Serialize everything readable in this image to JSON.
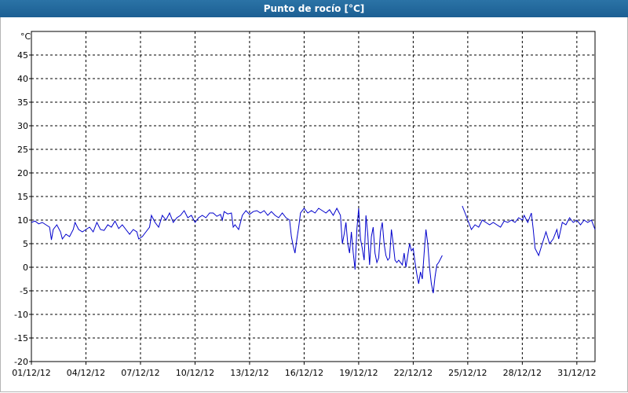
{
  "window": {
    "title": "Punto de rocío [°C]"
  },
  "chart_data": {
    "type": "line",
    "title": "Punto de rocío [°C]",
    "ylabel": "°C",
    "xlabel": "",
    "ylim": [
      -20,
      50
    ],
    "xlim": [
      0,
      31
    ],
    "y_ticks": [
      50,
      45,
      40,
      35,
      30,
      25,
      20,
      15,
      10,
      5,
      0,
      -5,
      -10,
      -15,
      -20
    ],
    "y_tick_labels": [
      "45",
      "40",
      "35",
      "30",
      "25",
      "20",
      "15",
      "10",
      "5",
      "0",
      "-5",
      "-10",
      "-15",
      "-20"
    ],
    "x_tick_labels": [
      "01/12/12",
      "04/12/12",
      "07/12/12",
      "10/12/12",
      "13/12/12",
      "16/12/12",
      "19/12/12",
      "22/12/12",
      "25/12/12",
      "28/12/12",
      "31/12/12"
    ],
    "x_tick_days": [
      0,
      3,
      6,
      9,
      12,
      15,
      18,
      21,
      24,
      27,
      30
    ],
    "grid": true,
    "line_color": "#0000cc",
    "series": [
      {
        "name": "",
        "segments": [
          [
            [
              0.0,
              9.5
            ],
            [
              0.2,
              9.8
            ],
            [
              0.4,
              9.2
            ],
            [
              0.6,
              9.5
            ],
            [
              0.8,
              9.0
            ],
            [
              1.0,
              8.5
            ],
            [
              1.1,
              5.8
            ],
            [
              1.2,
              8.0
            ],
            [
              1.4,
              9.0
            ],
            [
              1.6,
              7.5
            ],
            [
              1.7,
              6.0
            ],
            [
              1.9,
              7.0
            ],
            [
              2.1,
              6.5
            ],
            [
              2.3,
              8.0
            ],
            [
              2.4,
              9.5
            ],
            [
              2.6,
              8.0
            ],
            [
              2.8,
              7.5
            ],
            [
              3.0,
              8.0
            ],
            [
              3.2,
              8.5
            ],
            [
              3.4,
              7.5
            ],
            [
              3.6,
              9.5
            ],
            [
              3.8,
              8.0
            ],
            [
              4.0,
              7.8
            ],
            [
              4.2,
              9.0
            ],
            [
              4.4,
              8.5
            ],
            [
              4.6,
              9.8
            ],
            [
              4.8,
              8.2
            ],
            [
              5.0,
              9.0
            ],
            [
              5.2,
              8.0
            ],
            [
              5.4,
              7.0
            ],
            [
              5.6,
              8.0
            ],
            [
              5.8,
              7.5
            ],
            [
              5.9,
              6.0
            ],
            [
              6.1,
              6.5
            ],
            [
              6.3,
              7.5
            ],
            [
              6.5,
              8.5
            ],
            [
              6.6,
              11.0
            ],
            [
              6.8,
              9.5
            ],
            [
              7.0,
              8.5
            ],
            [
              7.2,
              11.0
            ],
            [
              7.4,
              10.0
            ],
            [
              7.6,
              11.5
            ],
            [
              7.8,
              9.5
            ],
            [
              8.0,
              10.5
            ],
            [
              8.2,
              11.0
            ],
            [
              8.4,
              12.0
            ],
            [
              8.6,
              10.5
            ],
            [
              8.8,
              11.0
            ],
            [
              9.0,
              9.5
            ],
            [
              9.2,
              10.5
            ],
            [
              9.4,
              11.0
            ],
            [
              9.6,
              10.5
            ],
            [
              9.8,
              11.5
            ],
            [
              10.0,
              11.5
            ],
            [
              10.2,
              10.8
            ],
            [
              10.4,
              11.2
            ],
            [
              10.5,
              10.0
            ],
            [
              10.6,
              11.8
            ],
            [
              10.8,
              11.3
            ],
            [
              11.0,
              11.5
            ],
            [
              11.1,
              8.5
            ],
            [
              11.2,
              9.0
            ],
            [
              11.4,
              8.0
            ],
            [
              11.6,
              11.0
            ],
            [
              11.8,
              12.0
            ],
            [
              12.0,
              11.2
            ],
            [
              12.2,
              11.8
            ],
            [
              12.4,
              12.0
            ],
            [
              12.6,
              11.5
            ],
            [
              12.8,
              12.0
            ],
            [
              13.0,
              11.0
            ],
            [
              13.2,
              11.8
            ],
            [
              13.4,
              11.0
            ],
            [
              13.6,
              10.5
            ],
            [
              13.8,
              11.5
            ],
            [
              14.0,
              10.5
            ],
            [
              14.2,
              10.0
            ],
            [
              14.3,
              6.5
            ],
            [
              14.4,
              4.5
            ],
            [
              14.5,
              3.0
            ],
            [
              14.6,
              6.0
            ],
            [
              14.7,
              8.5
            ],
            [
              14.8,
              11.5
            ],
            [
              15.0,
              12.5
            ],
            [
              15.2,
              11.5
            ],
            [
              15.4,
              12.0
            ],
            [
              15.6,
              11.5
            ],
            [
              15.8,
              12.5
            ],
            [
              16.0,
              12.0
            ],
            [
              16.2,
              11.5
            ],
            [
              16.4,
              12.2
            ],
            [
              16.6,
              11.0
            ],
            [
              16.8,
              12.5
            ],
            [
              17.0,
              11.0
            ],
            [
              17.1,
              5.0
            ],
            [
              17.2,
              7.0
            ],
            [
              17.3,
              9.5
            ],
            [
              17.4,
              5.0
            ],
            [
              17.5,
              3.0
            ],
            [
              17.6,
              7.5
            ],
            [
              17.7,
              3.0
            ],
            [
              17.8,
              -0.5
            ],
            [
              17.9,
              8.0
            ],
            [
              18.0,
              12.5
            ],
            [
              18.1,
              6.0
            ],
            [
              18.2,
              4.0
            ],
            [
              18.3,
              1.5
            ],
            [
              18.4,
              11.0
            ],
            [
              18.5,
              7.0
            ],
            [
              18.6,
              0.5
            ],
            [
              18.7,
              6.5
            ],
            [
              18.8,
              8.5
            ],
            [
              18.9,
              3.0
            ],
            [
              19.0,
              1.0
            ],
            [
              19.1,
              2.0
            ],
            [
              19.2,
              7.5
            ],
            [
              19.3,
              9.5
            ],
            [
              19.4,
              5.0
            ],
            [
              19.5,
              2.5
            ],
            [
              19.6,
              1.5
            ],
            [
              19.7,
              2.0
            ],
            [
              19.8,
              8.0
            ],
            [
              19.9,
              5.0
            ],
            [
              20.0,
              1.5
            ],
            [
              20.1,
              1.0
            ],
            [
              20.2,
              1.5
            ],
            [
              20.4,
              0.5
            ],
            [
              20.5,
              3.0
            ],
            [
              20.6,
              0.0
            ],
            [
              20.8,
              5.0
            ],
            [
              20.9,
              3.5
            ],
            [
              21.0,
              4.0
            ],
            [
              21.1,
              1.0
            ],
            [
              21.2,
              -1.5
            ],
            [
              21.3,
              -3.5
            ],
            [
              21.4,
              -1.0
            ],
            [
              21.5,
              -2.5
            ],
            [
              21.6,
              3.0
            ],
            [
              21.7,
              8.0
            ],
            [
              21.8,
              5.0
            ],
            [
              21.9,
              0.0
            ],
            [
              22.0,
              -3.5
            ],
            [
              22.1,
              -5.5
            ],
            [
              22.2,
              -2.0
            ],
            [
              22.3,
              0.5
            ],
            [
              22.4,
              1.0
            ],
            [
              22.6,
              2.5
            ]
          ],
          [
            [
              23.7,
              13.0
            ],
            [
              23.9,
              11.0
            ],
            [
              24.0,
              10.0
            ],
            [
              24.2,
              8.0
            ],
            [
              24.4,
              9.0
            ],
            [
              24.6,
              8.5
            ],
            [
              24.8,
              10.0
            ],
            [
              25.0,
              9.5
            ],
            [
              25.2,
              9.0
            ],
            [
              25.4,
              9.5
            ],
            [
              25.6,
              9.0
            ],
            [
              25.8,
              8.5
            ],
            [
              26.0,
              9.8
            ],
            [
              26.2,
              9.5
            ],
            [
              26.4,
              10.0
            ],
            [
              26.6,
              9.5
            ],
            [
              26.8,
              10.5
            ],
            [
              27.0,
              10.0
            ],
            [
              27.1,
              11.0
            ],
            [
              27.3,
              9.5
            ],
            [
              27.4,
              10.5
            ],
            [
              27.5,
              11.5
            ],
            [
              27.6,
              8.0
            ],
            [
              27.7,
              4.0
            ],
            [
              27.9,
              2.5
            ],
            [
              28.1,
              5.0
            ],
            [
              28.3,
              7.5
            ],
            [
              28.5,
              5.0
            ],
            [
              28.7,
              6.0
            ],
            [
              28.9,
              8.0
            ],
            [
              29.0,
              6.0
            ],
            [
              29.2,
              9.5
            ],
            [
              29.4,
              9.0
            ],
            [
              29.6,
              10.5
            ],
            [
              29.8,
              9.5
            ],
            [
              30.0,
              10.0
            ],
            [
              30.2,
              9.0
            ],
            [
              30.4,
              10.0
            ],
            [
              30.6,
              9.5
            ],
            [
              30.8,
              10.0
            ],
            [
              31.0,
              8.0
            ]
          ]
        ]
      }
    ]
  }
}
